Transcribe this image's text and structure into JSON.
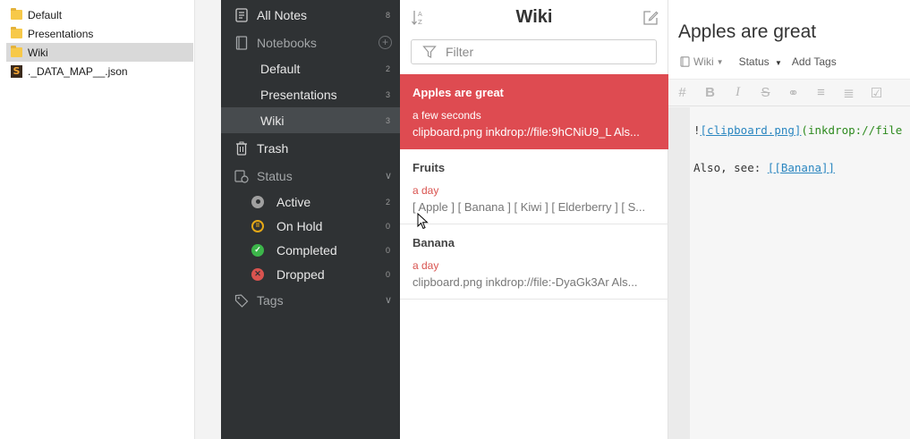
{
  "explorer": {
    "items": [
      {
        "label": "Default",
        "type": "folder"
      },
      {
        "label": "Presentations",
        "type": "folder"
      },
      {
        "label": "Wiki",
        "type": "folder",
        "selected": true
      },
      {
        "label": "._DATA_MAP__.json",
        "type": "file"
      }
    ]
  },
  "sidebar": {
    "all_notes": {
      "label": "All Notes",
      "count": "8"
    },
    "notebooks": {
      "label": "Notebooks"
    },
    "notebook_items": [
      {
        "label": "Default",
        "count": "2"
      },
      {
        "label": "Presentations",
        "count": "3"
      },
      {
        "label": "Wiki",
        "count": "3"
      }
    ],
    "trash": {
      "label": "Trash"
    },
    "status": {
      "label": "Status"
    },
    "status_items": [
      {
        "label": "Active",
        "count": "2",
        "color": "#a0a0a0"
      },
      {
        "label": "On Hold",
        "count": "0",
        "color": "#e6a817"
      },
      {
        "label": "Completed",
        "count": "0",
        "color": "#3cb54a"
      },
      {
        "label": "Dropped",
        "count": "0",
        "color": "#d9534f"
      }
    ],
    "tags": {
      "label": "Tags"
    }
  },
  "notelist": {
    "title": "Wiki",
    "filter_placeholder": "Filter",
    "notes": [
      {
        "title": "Apples are great",
        "date": "a few seconds",
        "body": "clipboard.png inkdrop://file:9hCNiU9_L Als..."
      },
      {
        "title": "Fruits",
        "date": "a day",
        "body": "[ Apple ] [ Banana ] [ Kiwi ] [ Elderberry ] [ S..."
      },
      {
        "title": "Banana",
        "date": "a day",
        "body": "clipboard.png inkdrop://file:-DyaGk3Ar Als..."
      }
    ]
  },
  "editor": {
    "title": "Apples are great",
    "notebook": "Wiki",
    "status": "Status",
    "add_tags": "Add Tags",
    "line1": {
      "bang": "!",
      "link_text": "[clipboard.png]",
      "url": "(inkdrop://file"
    },
    "line2": {
      "prefix": "Also, see: ",
      "wiki_link": "[[Banana]]"
    }
  },
  "colors": {
    "sidebar_bg": "#2f3234",
    "accent": "#de4b51"
  }
}
